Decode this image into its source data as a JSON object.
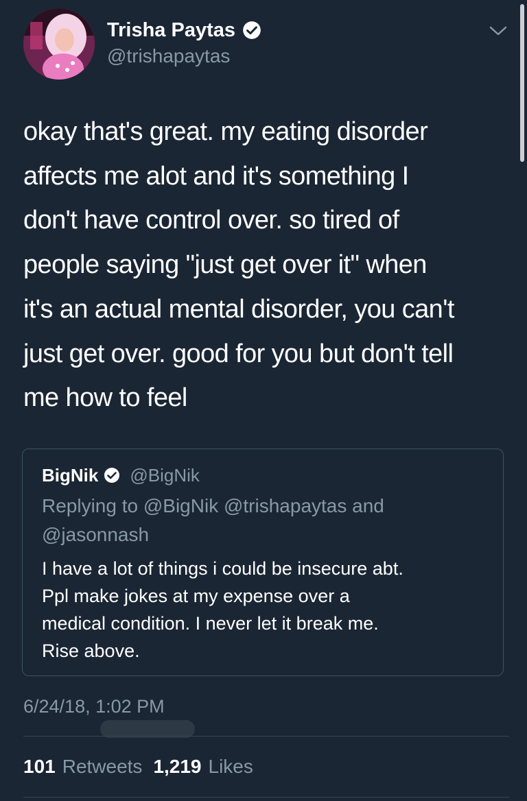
{
  "author": {
    "display_name": "Trisha Paytas",
    "handle": "@trishapaytas",
    "verified": true
  },
  "tweet": {
    "text": "okay that's great. my eating disorder\naffects me alot and it's something I\ndon't have control over. so tired of\npeople saying \"just get over it\" when\nit's an actual mental disorder, you can't\njust get over. good for you but don't tell\nme how to feel",
    "timestamp": "6/24/18, 1:02 PM"
  },
  "quoted_tweet": {
    "display_name": "BigNik",
    "handle": "@BigNik",
    "verified": true,
    "replying_to": "Replying to @BigNik @trishapaytas and @jasonnash",
    "text": "I have a lot of things i could be insecure abt.\nPpl make jokes at my expense over a\nmedical condition. I never let it break me.\nRise above."
  },
  "stats": {
    "retweets_count": "101",
    "retweets_label": "Retweets",
    "likes_count": "1,219",
    "likes_label": "Likes"
  },
  "icons": {
    "verified": "verified-badge-icon",
    "more": "chevron-down-icon"
  },
  "colors": {
    "background": "#1b2634",
    "secondary_text": "#8899a6",
    "border": "#3d5266"
  }
}
